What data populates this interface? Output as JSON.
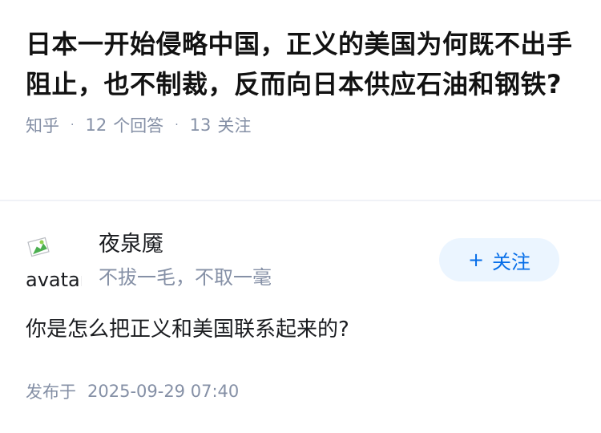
{
  "question": {
    "title": "日本一开始侵略中国，正义的美国为何既不出手阻止，也不制裁，反而向日本供应石油和钢铁?",
    "source": "知乎",
    "answer_count": "12",
    "answer_label": "个回答",
    "follow_count": "13",
    "follow_label": "关注",
    "separator": "·"
  },
  "answer": {
    "author": {
      "avatar_alt": "avatar",
      "name": "夜泉魇",
      "bio": "不拔一毛，不取一毫"
    },
    "follow_button": {
      "icon": "+",
      "label": "关注"
    },
    "content": "你是怎么把正义和美国联系起来的?",
    "publish_label": "发布于",
    "publish_time": "2025-09-29 07:40"
  },
  "colors": {
    "meta_gray": "#8590a6",
    "accent_blue": "#056de8",
    "button_bg": "#ebf5ff"
  }
}
